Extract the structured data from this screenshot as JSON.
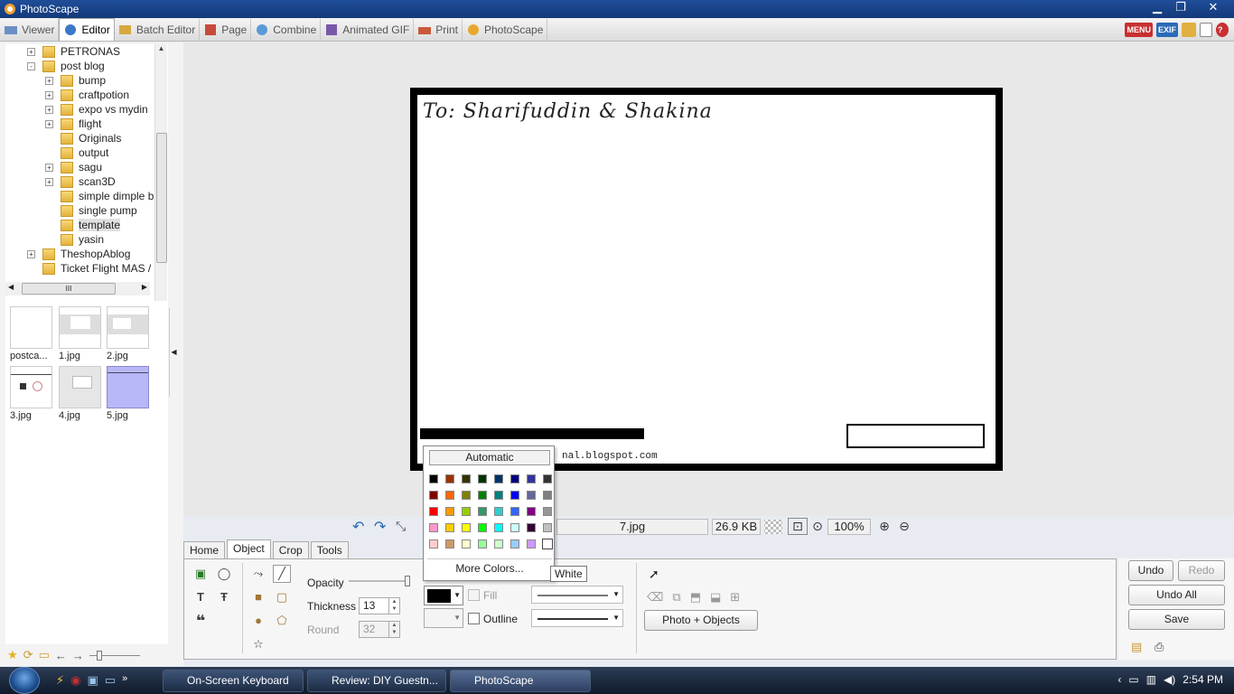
{
  "window": {
    "title": "PhotoScape"
  },
  "tabs": [
    {
      "label": "Viewer"
    },
    {
      "label": "Editor"
    },
    {
      "label": "Batch Editor"
    },
    {
      "label": "Page"
    },
    {
      "label": "Combine"
    },
    {
      "label": "Animated GIF"
    },
    {
      "label": "Print"
    },
    {
      "label": "PhotoScape"
    }
  ],
  "top_icons": [
    "MENU",
    "EXIF"
  ],
  "tree": {
    "items": [
      {
        "label": "PETRONAS",
        "expander": "+"
      },
      {
        "label": "post blog",
        "expander": "-"
      },
      {
        "label": "bump",
        "expander": "+"
      },
      {
        "label": "craftpotion",
        "expander": "+"
      },
      {
        "label": "expo vs mydin",
        "expander": "+"
      },
      {
        "label": "flight",
        "expander": "+"
      },
      {
        "label": "Originals",
        "expander": ""
      },
      {
        "label": "output",
        "expander": ""
      },
      {
        "label": "sagu",
        "expander": "+"
      },
      {
        "label": "scan3D",
        "expander": "+"
      },
      {
        "label": "simple dimple b",
        "expander": ""
      },
      {
        "label": "single pump",
        "expander": ""
      },
      {
        "label": "template",
        "expander": ""
      },
      {
        "label": "yasin",
        "expander": ""
      },
      {
        "label": "TheshopAblog",
        "expander": "+"
      },
      {
        "label": "Ticket Flight MAS /",
        "expander": ""
      }
    ],
    "hscroll_grip": "III"
  },
  "thumbnails": [
    {
      "label": "postca..."
    },
    {
      "label": "1.jpg"
    },
    {
      "label": "2.jpg"
    },
    {
      "label": "3.jpg"
    },
    {
      "label": "4.jpg"
    },
    {
      "label": "5.jpg"
    }
  ],
  "card": {
    "to_text": "To:  Sharifuddin  &  Shakina",
    "url_text": "nal.blogspot.com"
  },
  "status": {
    "index": "4",
    "filename": "7.jpg",
    "filesize": "26.9 KB",
    "zoom": "100%"
  },
  "lower_tabs": [
    {
      "label": "Home"
    },
    {
      "label": "Object"
    },
    {
      "label": "Crop"
    },
    {
      "label": "Tools"
    }
  ],
  "object_panel": {
    "opacity_label": "Opacity",
    "opacity_level": 1.0,
    "thickness_label": "Thickness",
    "thickness_value": "13",
    "round_label": "Round",
    "round_value": "32",
    "fill_label": "Fill",
    "outline_label": "Outline",
    "photo_objects_button": "Photo + Objects"
  },
  "color_popup": {
    "automatic_label": "Automatic",
    "more_colors_label": "More Colors...",
    "tooltip": "White",
    "swatches": [
      [
        "#000000",
        "#993300",
        "#333300",
        "#003300",
        "#003366",
        "#000080",
        "#333399",
        "#333333"
      ],
      [
        "#800000",
        "#ff6600",
        "#808000",
        "#008000",
        "#008080",
        "#0000ff",
        "#666699",
        "#808080"
      ],
      [
        "#ff0000",
        "#ff9900",
        "#99cc00",
        "#339966",
        "#33cccc",
        "#3366ff",
        "#800080",
        "#969696"
      ],
      [
        "#ff99cc",
        "#ffcc00",
        "#ffff00",
        "#00ff00",
        "#00ffff",
        "#ccffff",
        "#330033",
        "#c0c0c0"
      ],
      [
        "#ffcccc",
        "#cc9966",
        "#ffffcc",
        "#99ff99",
        "#ccffcc",
        "#99ccff",
        "#cc99ff",
        "#ffffff"
      ]
    ]
  },
  "right_buttons": {
    "undo": "Undo",
    "redo": "Redo",
    "undo_all": "Undo All",
    "save": "Save"
  },
  "taskbar": {
    "buttons": [
      {
        "label": "On-Screen Keyboard"
      },
      {
        "label": "Review: DIY Guestn..."
      },
      {
        "label": "PhotoScape"
      }
    ],
    "clock": "2:54 PM"
  }
}
